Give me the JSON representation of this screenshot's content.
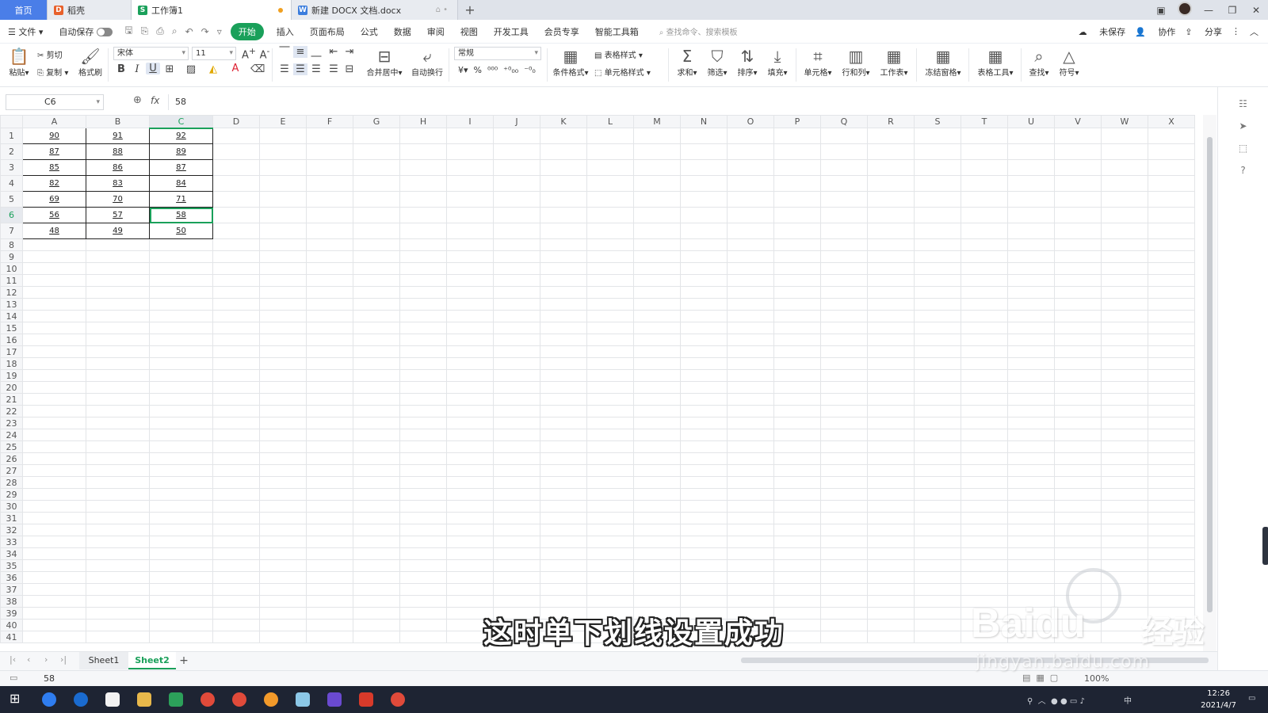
{
  "tabs": [
    {
      "label": "首页"
    },
    {
      "label": "稻壳"
    },
    {
      "label": "工作簿1"
    },
    {
      "label": "新建 DOCX 文档.docx"
    }
  ],
  "menu": {
    "file": "文件",
    "autosave": "自动保存",
    "items": [
      "开始",
      "插入",
      "页面布局",
      "公式",
      "数据",
      "审阅",
      "视图",
      "开发工具",
      "会员专享",
      "智能工具箱"
    ],
    "search_placeholder": "查找命令、搜索模板",
    "unsaved": "未保存",
    "collab": "协作",
    "share": "分享"
  },
  "ribbon": {
    "paste": "粘贴",
    "cut": "剪切",
    "copy": "复制",
    "format_painter": "格式刷",
    "font_name": "宋体",
    "font_size": "11",
    "bold": "B",
    "italic": "I",
    "underline": "U",
    "merge_center": "合并居中",
    "wrap_text": "自动换行",
    "number_format": "常规",
    "cond_format": "条件格式",
    "table_style": "表格样式",
    "cell_style": "单元格样式",
    "sum": "求和",
    "filter": "筛选",
    "sort": "排序",
    "fill": "填充",
    "cell": "单元格",
    "row_col": "行和列",
    "worksheet": "工作表",
    "freeze": "冻结窗格",
    "table_tools": "表格工具",
    "find": "查找",
    "symbol": "符号"
  },
  "formula_bar": {
    "cell_ref": "C6",
    "fx": "fx",
    "value": "58"
  },
  "grid": {
    "columns": [
      "A",
      "B",
      "C",
      "D",
      "E",
      "F",
      "G",
      "H",
      "I",
      "J",
      "K",
      "L",
      "M",
      "N",
      "O",
      "P",
      "Q",
      "R",
      "S",
      "T",
      "U",
      "V",
      "W",
      "X"
    ],
    "active_cell": "C6",
    "rows": [
      [
        "90",
        "91",
        "92"
      ],
      [
        "87",
        "88",
        "89"
      ],
      [
        "85",
        "86",
        "87"
      ],
      [
        "82",
        "83",
        "84"
      ],
      [
        "69",
        "70",
        "71"
      ],
      [
        "56",
        "57",
        "58"
      ],
      [
        "48",
        "49",
        "50"
      ]
    ],
    "total_rows": 41
  },
  "sheets": [
    "Sheet1",
    "Sheet2"
  ],
  "active_sheet": "Sheet2",
  "status": {
    "value": "58",
    "zoom": "100%"
  },
  "taskbar": {
    "time": "12:26",
    "date": "2021/4/7",
    "ime": "中"
  },
  "overlay": {
    "subtitle": "这时单下划线设置成功",
    "watermark_brand": "Baidu",
    "watermark_cn": "经验",
    "watermark_url": "jingyan.baidu.com"
  },
  "colors": {
    "accent": "#1aa05a",
    "home_tab": "#4a7ee8",
    "taskbar": "#1e2433"
  }
}
